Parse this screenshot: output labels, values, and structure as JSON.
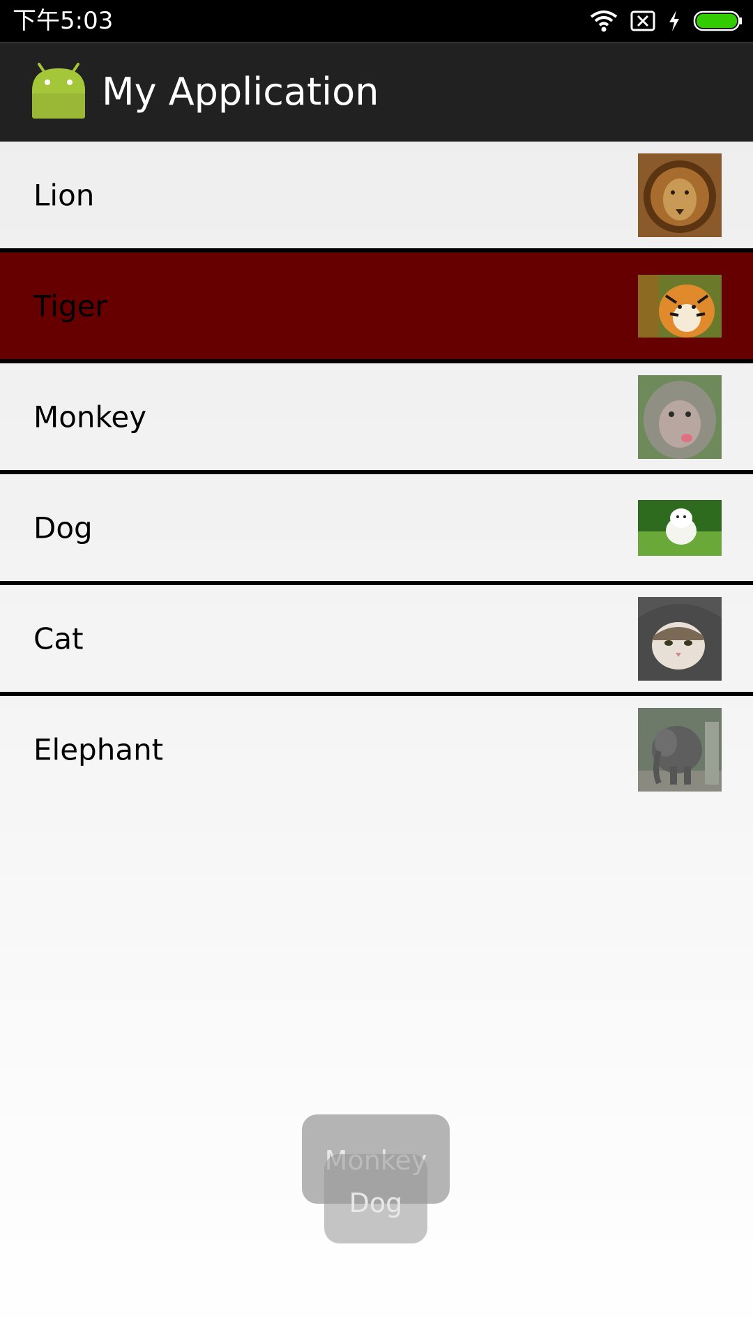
{
  "status_bar": {
    "time": "下午5:03",
    "icons": [
      "wifi-icon",
      "no-sim-icon",
      "charging-icon",
      "battery-icon"
    ],
    "battery_color": "#33cc00"
  },
  "action_bar": {
    "title": "My Application",
    "icon": "android-icon",
    "icon_color": "#a4c639",
    "background": "#212121"
  },
  "list": {
    "selected_color": "#660000",
    "items": [
      {
        "label": "Lion",
        "image": "lion-image"
      },
      {
        "label": "Tiger",
        "image": "tiger-image",
        "selected": true
      },
      {
        "label": "Monkey",
        "image": "monkey-image"
      },
      {
        "label": "Dog",
        "image": "dog-image"
      },
      {
        "label": "Cat",
        "image": "cat-image"
      },
      {
        "label": "Elephant",
        "image": "elephant-image"
      }
    ]
  },
  "toasts": [
    {
      "text": "Monkey"
    },
    {
      "text": "Dog"
    }
  ]
}
